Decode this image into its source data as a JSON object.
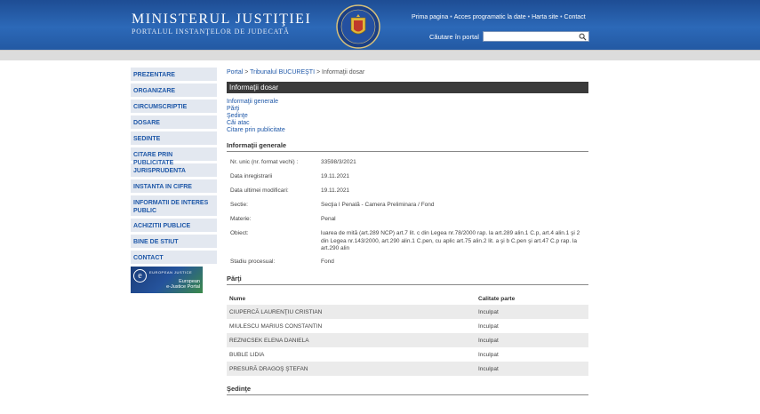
{
  "header": {
    "title": "MINISTERUL JUSTIŢIEI",
    "subtitle": "PORTALUL INSTANŢELOR DE JUDECATĂ",
    "links": [
      "Prima pagina",
      "Acces programatic la date",
      "Harta site",
      "Contact"
    ],
    "search_label": "Căutare în portal",
    "search_placeholder": ""
  },
  "sidebar": {
    "items": [
      "PREZENTARE",
      "ORGANIZARE",
      "CIRCUMSCRIPTIE",
      "DOSARE",
      "SEDINTE",
      "CITARE PRIN PUBLICITATE",
      "JURISPRUDENTA",
      "INSTANTA IN CIFRE",
      "INFORMATII DE INTERES PUBLIC",
      "ACHIZITII PUBLICE",
      "BINE DE STIUT",
      "CONTACT"
    ],
    "ejustice": {
      "small": "EUROPEAN JUSTICE",
      "line1": "European",
      "line2": "e-Justice Portal"
    }
  },
  "breadcrumb": {
    "items": [
      "Portal",
      "Tribunalul BUCUREŞTI",
      "Informaţii dosar"
    ]
  },
  "page_title": "Informaţii dosar",
  "anchors": [
    "Informaţii generale",
    "Părţi",
    "Şedinţe",
    "Căi atac",
    "Citare prin publicitate"
  ],
  "general": {
    "title": "Informaţii generale",
    "fields": [
      {
        "label": "Nr. unic (nr. format vechi) :",
        "value": "33598/3/2021"
      },
      {
        "label": "Data inregistrarii",
        "value": "19.11.2021"
      },
      {
        "label": "Data ultimei modificari:",
        "value": "19.11.2021"
      },
      {
        "label": "Sectie:",
        "value": "Secţia I Penală - Camera Preliminara / Fond"
      },
      {
        "label": "Materie:",
        "value": "Penal"
      },
      {
        "label": "Obiect:",
        "value": "luarea de mită (art.289 NCP) art.7 lit. c din Legea nr.78/2000 rap. la art.289 alin.1 C.p, art.4 alin.1 şi 2 din Legea nr.143/2000, art.290 alin.1 C.pen, cu aplic art.75 alin.2 lit. a şi b C.pen şi art.47 C.p rap. la art.290 alin"
      },
      {
        "label": "Stadiu procesual:",
        "value": "Fond"
      }
    ]
  },
  "parti": {
    "title": "Părţi",
    "columns": [
      "Nume",
      "Calitate parte"
    ],
    "rows": [
      [
        "CIUPERCĂ LAURENŢIU CRISTIAN",
        "Inculpat"
      ],
      [
        "MIULESCU MARIUS CONSTANTIN",
        "Inculpat"
      ],
      [
        "REZNICSEK ELENA DANIELA",
        "Inculpat"
      ],
      [
        "BUBLE LIDIA",
        "Inculpat"
      ],
      [
        "PRESURĂ DRAGOŞ ŞTEFAN",
        "Inculpat"
      ]
    ]
  },
  "sedinte": {
    "title": "Şedinţe"
  },
  "colors": {
    "header_blue": "#2c69b8",
    "link_blue": "#1f58a8",
    "sidebar_bg": "#e3e8f0",
    "title_bar": "#3a3a3a"
  }
}
